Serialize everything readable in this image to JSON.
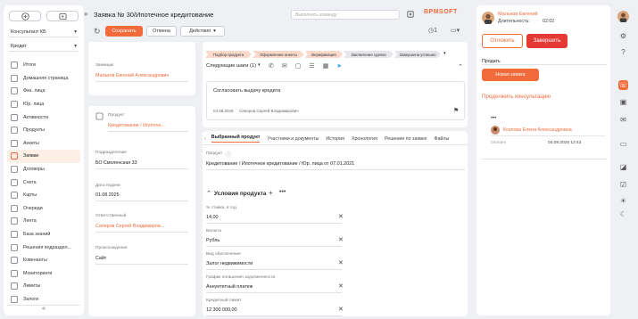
{
  "sidebar": {
    "account_select": "Консультант КБ",
    "section_select": "Кредит",
    "items": [
      {
        "label": "Итоги"
      },
      {
        "label": "Домашняя страница"
      },
      {
        "label": "Физ. лица"
      },
      {
        "label": "Юр. лица"
      },
      {
        "label": "Активности"
      },
      {
        "label": "Продукты"
      },
      {
        "label": "Анкеты"
      },
      {
        "label": "Заявки"
      },
      {
        "label": "Договоры"
      },
      {
        "label": "Счета"
      },
      {
        "label": "Карты"
      },
      {
        "label": "Очереди"
      },
      {
        "label": "Лента"
      },
      {
        "label": "База знаний"
      },
      {
        "label": "Решения подраздел..."
      },
      {
        "label": "Ковенанты"
      },
      {
        "label": "Мониторинги"
      },
      {
        "label": "Лимиты"
      },
      {
        "label": "Залоги"
      }
    ],
    "active_index": 7,
    "collapse_glyph": "«"
  },
  "header": {
    "title": "Заявка № 30/Ипотечное кредитование",
    "command_placeholder": "Выполнить команду",
    "logo": "BPMSOFT",
    "logo_sub": " "
  },
  "toolbar": {
    "save": "Сохранить",
    "cancel": "Отмена",
    "actions": "Действия",
    "counter": "1"
  },
  "form": {
    "fields": [
      {
        "label": "Заемщик",
        "value": "Мальков Евгений Александрович",
        "link": true
      },
      {
        "label": "Продукт",
        "value": "Кредитование / Ипотечн...",
        "link": true
      },
      {
        "label": "Подразделение",
        "value": "БО Смоленская 33",
        "link": false
      },
      {
        "label": "Дата подачи",
        "value": "01.08.2025",
        "link": false
      },
      {
        "label": "Ответственный",
        "value": "Саперов Сергей Владимиров...",
        "link": true
      },
      {
        "label": "Происхождение",
        "value": "Сайт",
        "link": false
      }
    ]
  },
  "stages": [
    {
      "label": "Подбор продукта",
      "done": true
    },
    {
      "label": "Оформление анкеты",
      "done": true
    },
    {
      "label": "Верификация",
      "done": true
    },
    {
      "label": "Заключение сделки",
      "done": false
    },
    {
      "label": "Завершена успешно",
      "done": false
    }
  ],
  "next_steps": {
    "title": "Следующие шаги (1)",
    "task_title": "Согласовать выдачу кредита",
    "task_date": "04.08.2025",
    "task_owner": "Саперов Сергей Владимирович"
  },
  "tabs": [
    "Выбранный продукт",
    "Участники и документы",
    "История",
    "Хронология",
    "Решение по заявке",
    "Файлы"
  ],
  "product": {
    "label": "Продукт",
    "value": "Кредитование / Ипотечное кредитование / Юр. лица от 07.01.2021",
    "conditions_title": "Условия продукта",
    "conditions": [
      {
        "label": "% ставка, в год",
        "value": "14,00"
      },
      {
        "label": "Валюта",
        "value": "Рубль"
      },
      {
        "label": "Вид обеспечения",
        "value": "Залог недвижимости"
      },
      {
        "label": "График погашения задолженности",
        "value": "Аннуитетный платеж"
      },
      {
        "label": "Кредитный лимит",
        "value": "12 300 000,00"
      }
    ]
  },
  "right_panel": {
    "name": "Мальков Евгений",
    "duration_label": "Длительность:",
    "duration": "02:02",
    "postpone": "Отложить",
    "finish": "Завершить",
    "section": "Продать",
    "new_request": "Новая заявка",
    "continue_link": "Продолжить консультацию",
    "ellipsis": "•••",
    "consultant": "Козлова Елена Александровна",
    "state": "Оплаен",
    "date": "04.08.2025 12:43"
  },
  "colors": {
    "accent": "#f26b3a",
    "danger": "#e53935"
  }
}
